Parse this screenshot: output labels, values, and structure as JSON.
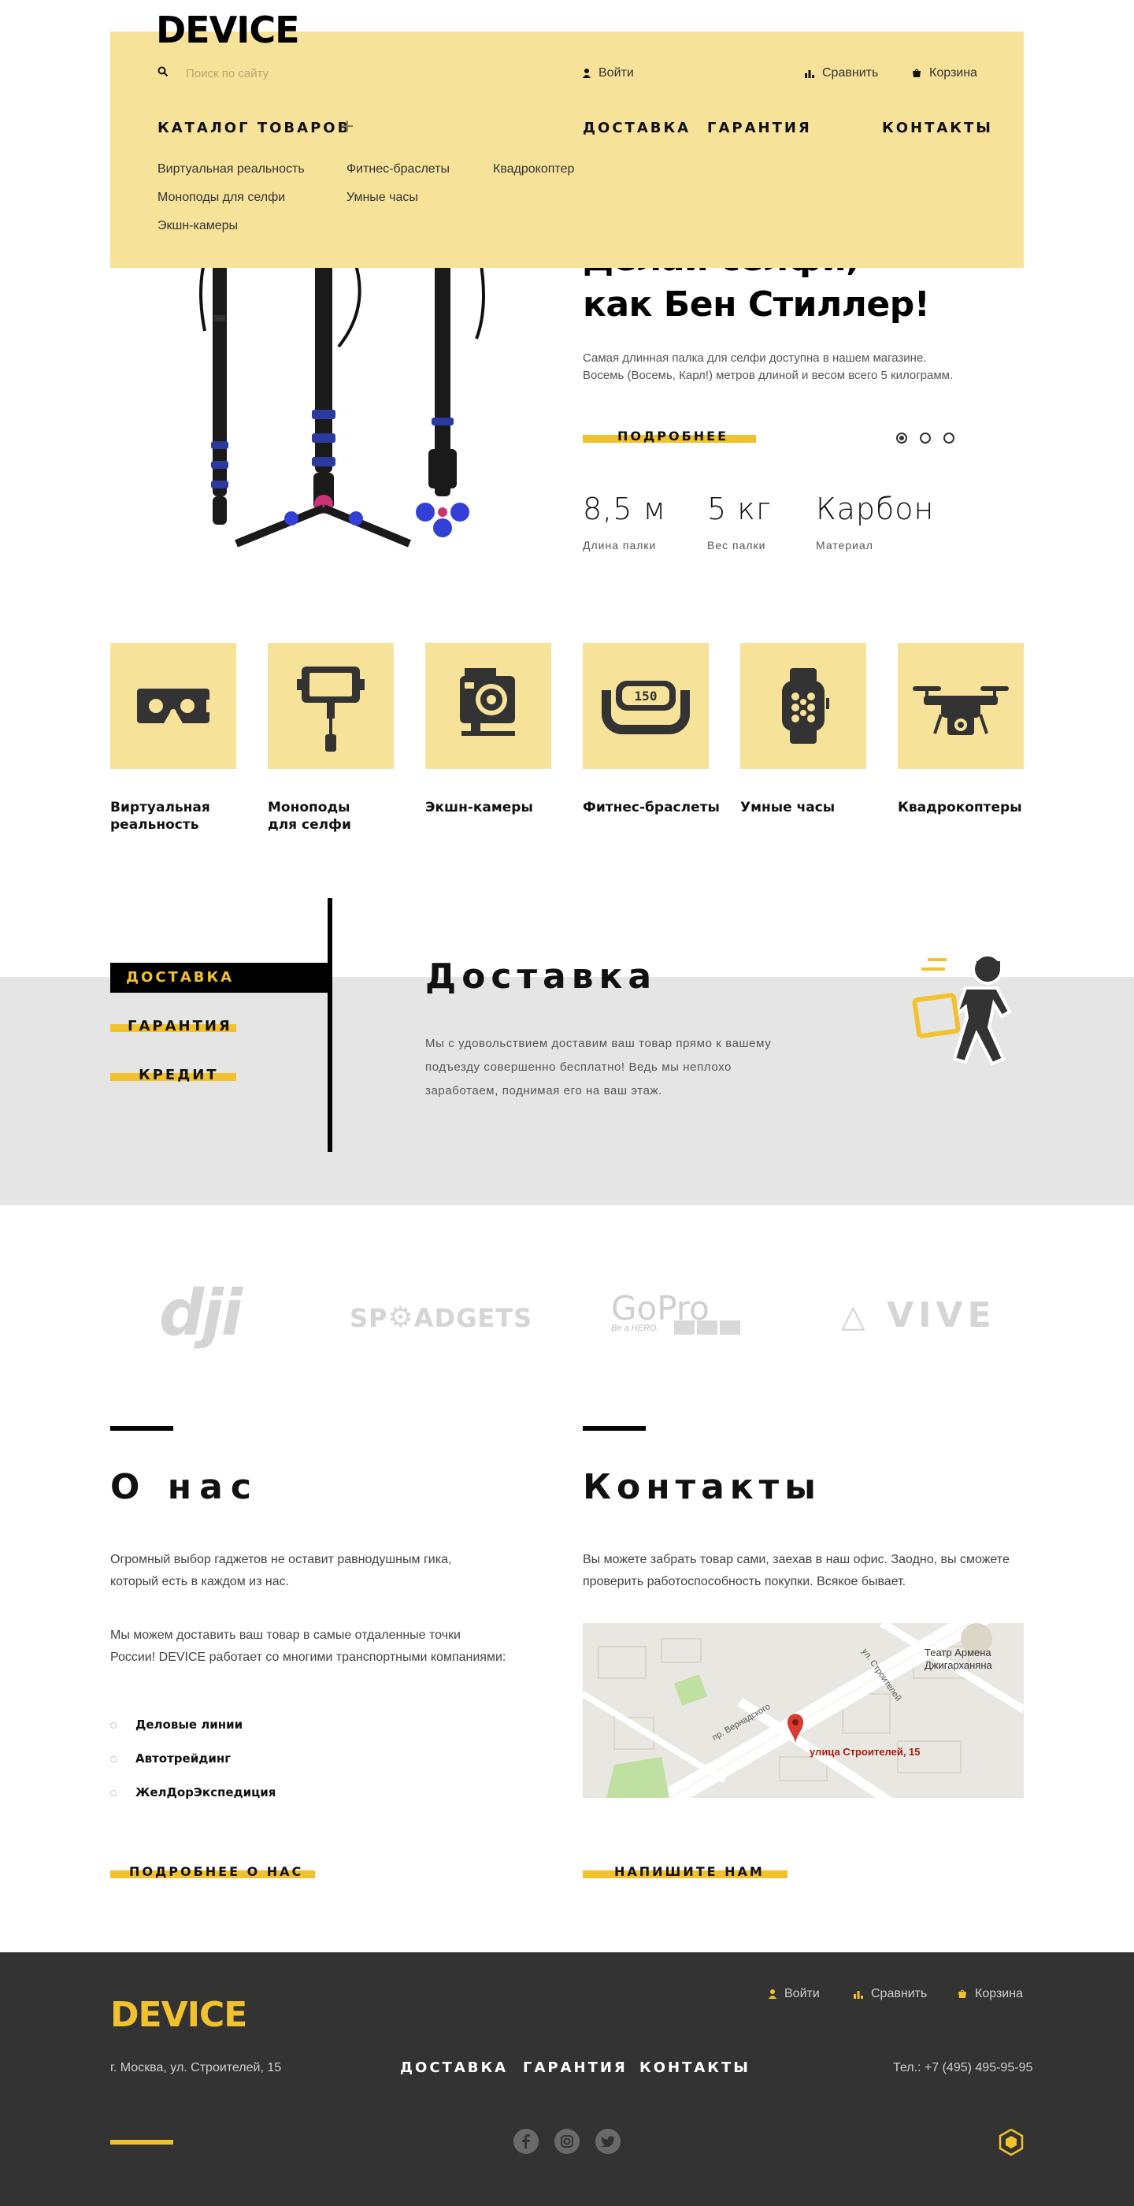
{
  "header": {
    "logo": "DEVICE",
    "search_placeholder": "Поиск по сайту",
    "login": "Войти",
    "compare": "Сравнить",
    "cart": "Корзина",
    "catalog": "КАТАЛОГ ТОВАРОВ",
    "nav": [
      "ДОСТАВКА",
      "ГАРАНТИЯ",
      "КОНТАКТЫ"
    ],
    "catalog_items": [
      "Виртуальная реальность",
      "Фитнес-браслеты",
      "Квадрокоптер",
      "Моноподы для селфи",
      "Умные часы",
      "Экшн-камеры"
    ]
  },
  "hero": {
    "title_line1": "Делай селфи,",
    "title_line2": "как Бен Стиллер!",
    "desc_line1": "Самая длинная палка для селфи доступна в нашем магазине.",
    "desc_line2": "Восемь (Восемь, Карл!) метров длиной и весом всего 5 килограмм.",
    "more": "ПОДРОБНЕЕ",
    "active_slide": 1,
    "stats": [
      {
        "value": "8,5 м",
        "label": "Длина палки"
      },
      {
        "value": "5 кг",
        "label": "Вес палки"
      },
      {
        "value": "Карбон",
        "label": "Материал"
      }
    ]
  },
  "categories": [
    {
      "line1": "Виртуальная",
      "line2": "реальность",
      "icon": "vr-headset-icon"
    },
    {
      "line1": "Моноподы",
      "line2": "для селфи",
      "icon": "selfie-stick-icon"
    },
    {
      "line1": "Экшн-камеры",
      "line2": "",
      "icon": "action-camera-icon"
    },
    {
      "line1": "Фитнес-браслеты",
      "line2": "",
      "icon": "fitness-band-icon"
    },
    {
      "line1": "Умные часы",
      "line2": "",
      "icon": "smartwatch-icon"
    },
    {
      "line1": "Квадрокоптеры",
      "line2": "",
      "icon": "drone-icon"
    }
  ],
  "fitness_display": "150",
  "services": {
    "tabs": [
      "ДОСТАВКА",
      "ГАРАНТИЯ",
      "КРЕДИТ"
    ],
    "active_tab": 0,
    "title": "Доставка",
    "text_line1": "Мы с удовольствием доставим ваш товар прямо к вашему",
    "text_line2": "подъезду совершенно бесплатно! Ведь мы неплохо",
    "text_line3": "заработаем, поднимая его на ваш этаж."
  },
  "brands": {
    "dji": "dji",
    "sp_prefix": "SP",
    "sp_suffix": "ADGETS",
    "gopro": "GoPro",
    "gopro_tag": "Be a HERO.",
    "vive": "VIVE"
  },
  "about": {
    "title": "О нас",
    "p1_line1": "Огромный выбор гаджетов не оставит равнодушным гика,",
    "p1_line2": "который есть в каждом из нас.",
    "p2_line1": "Мы можем доставить ваш товар в самые отдаленные точки",
    "p2_line2": "России! DEVICE работает со многими транспортными компаниями:",
    "partners": [
      "Деловые линии",
      "Автотрейдинг",
      "ЖелДорЭкспедиция"
    ],
    "more": "ПОДРОБНЕЕ О НАС"
  },
  "contacts": {
    "title": "Контакты",
    "p_line1": "Вы можете забрать товар сами, заехав в наш офис. Заодно, вы сможете",
    "p_line2": "проверить работоспособность покупки. Всякое бывает.",
    "map": {
      "street1": "пр. Вернадского",
      "street2": "ул. Строителей",
      "theatre_line1": "Театр Армена",
      "theatre_line2": "Джигарханяна",
      "marker": "улица Строителей, 15"
    },
    "write": "НАПИШИТЕ НАМ"
  },
  "footer": {
    "logo": "DEVICE",
    "login": "Войти",
    "compare": "Сравнить",
    "cart": "Корзина",
    "address": "г. Москва, ул. Строителей, 15",
    "nav": [
      "ДОСТАВКА",
      "ГАРАНТИЯ",
      "КОНТАКТЫ"
    ],
    "phone": "Тел.: +7 (495) 495-95-95",
    "socials": [
      "facebook-icon",
      "instagram-icon",
      "twitter-icon"
    ]
  },
  "colors": {
    "accent_yellow": "#f2c12e",
    "panel_yellow": "#f7e29a",
    "footer_bg": "#333333",
    "band_gray": "#e5e5e5"
  }
}
